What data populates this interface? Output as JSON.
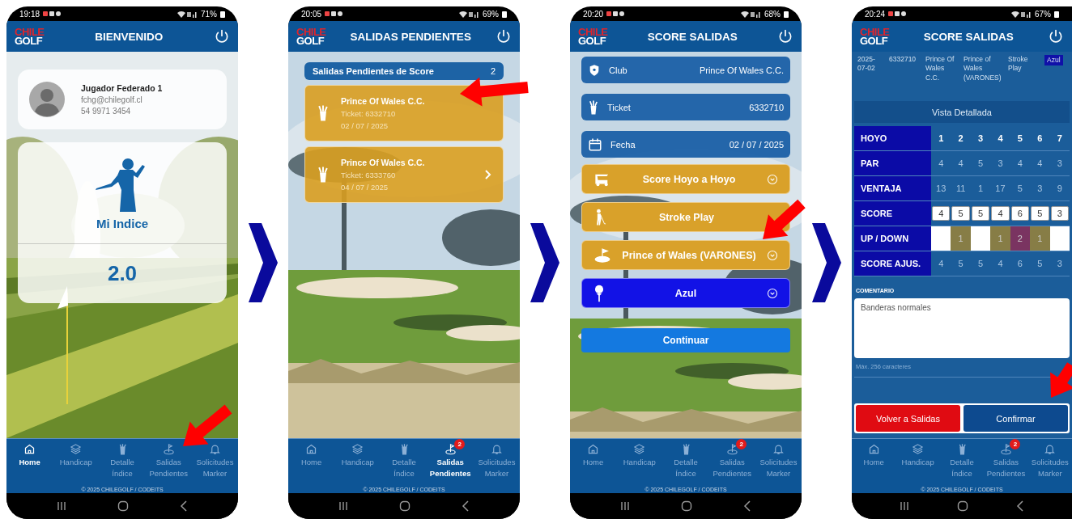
{
  "phones": [
    {
      "kind": "home",
      "status_bar": {
        "time": "19:18",
        "battery": "71%"
      },
      "header": {
        "logo_top": "CHILE",
        "logo_bottom": "GOLF",
        "title": "BIENVENIDO"
      },
      "profile": {
        "name": "Jugador Federado 1",
        "email": "fchg@chilegolf.cl",
        "phone": "54 9971 3454"
      },
      "index_card": {
        "label": "Mi Indice",
        "value": "2.0"
      },
      "nav": [
        {
          "label": "Home",
          "selected": true
        },
        {
          "label": "Handicap",
          "selected": false
        },
        {
          "label": "Detalle\nÍndice",
          "selected": false
        },
        {
          "label": "Salidas\nPendientes",
          "selected": false
        },
        {
          "label": "Solicitudes\nMarker",
          "selected": false
        }
      ],
      "copyright": "© 2025 CHILEGOLF / CODEITS"
    },
    {
      "kind": "pending",
      "status_bar": {
        "time": "20:05",
        "battery": "69%"
      },
      "header": {
        "logo_top": "CHILE",
        "logo_bottom": "GOLF",
        "title": "SALIDAS PENDIENTES"
      },
      "list_header": {
        "title": "Salidas Pendientes de Score",
        "count": "2"
      },
      "outings": [
        {
          "club": "Prince Of Wales C.C.",
          "ticket": "Ticket: 6332710",
          "date": "02 / 07 / 2025",
          "chevron": false
        },
        {
          "club": "Prince Of Wales C.C.",
          "ticket": "Ticket: 6333760",
          "date": "04 / 07 / 2025",
          "chevron": true
        }
      ],
      "nav": [
        {
          "label": "Home",
          "selected": false
        },
        {
          "label": "Handicap",
          "selected": false
        },
        {
          "label": "Detalle\nÍndice",
          "selected": false
        },
        {
          "label": "Salidas\nPendientes",
          "selected": true,
          "badge": "2"
        },
        {
          "label": "Solicitudes\nMarker",
          "selected": false
        }
      ],
      "copyright": "© 2025 CHILEGOLF / CODEITS"
    },
    {
      "kind": "score_form",
      "status_bar": {
        "time": "20:20",
        "battery": "68%"
      },
      "header": {
        "logo_top": "CHILE",
        "logo_bottom": "GOLF",
        "title": "SCORE SALIDAS"
      },
      "info_rows": [
        {
          "label": "Club",
          "value": "Prince Of Wales C.C."
        },
        {
          "label": "Ticket",
          "value": "6332710"
        },
        {
          "label": "Fecha",
          "value": "02 / 07 / 2025"
        }
      ],
      "selects": [
        {
          "label": "Score Hoyo a Hoyo",
          "color": "#d9a12a",
          "dropdown": true
        },
        {
          "label": "Stroke Play",
          "color": "#d9a12a",
          "dropdown": false
        },
        {
          "label": "Prince of Wales (VARONES)",
          "color": "#d9a12a",
          "dropdown": true
        },
        {
          "label": "Azul",
          "color": "#1212e6",
          "dropdown": true
        }
      ],
      "continue_button": "Continuar",
      "nav": [
        {
          "label": "Home",
          "selected": false
        },
        {
          "label": "Handicap",
          "selected": false
        },
        {
          "label": "Detalle\nÍndice",
          "selected": false
        },
        {
          "label": "Salidas\nPendientes",
          "selected": false,
          "badge": "2"
        },
        {
          "label": "Solicitudes\nMarker",
          "selected": false
        }
      ],
      "copyright": "© 2025 CHILEGOLF / CODEITS"
    },
    {
      "kind": "scorecard",
      "status_bar": {
        "time": "20:24",
        "battery": "67%"
      },
      "header": {
        "logo_top": "CHILE",
        "logo_bottom": "GOLF",
        "title": "SCORE SALIDAS"
      },
      "summary": [
        {
          "text": "2025-07-02",
          "highlighted": false
        },
        {
          "text": "6332710",
          "highlighted": false
        },
        {
          "text": "Prince Of Wales C.C.",
          "highlighted": false
        },
        {
          "text": "Prince of Wales (VARONES)",
          "highlighted": false
        },
        {
          "text": "Stroke Play",
          "highlighted": false
        },
        {
          "text": "Azul",
          "highlighted": true
        }
      ],
      "detail_bar": "Vista Detallada",
      "table": [
        {
          "label": "HOYO",
          "kind": "head",
          "cells": [
            "1",
            "2",
            "3",
            "4",
            "5",
            "6",
            "7"
          ]
        },
        {
          "label": "PAR",
          "kind": "plain",
          "cells": [
            "4",
            "4",
            "5",
            "3",
            "4",
            "4",
            "3"
          ]
        },
        {
          "label": "VENTAJA",
          "kind": "plain",
          "cells": [
            "13",
            "11",
            "1",
            "17",
            "5",
            "3",
            "9"
          ]
        },
        {
          "label": "SCORE",
          "kind": "input",
          "cells": [
            "4",
            "5",
            "5",
            "4",
            "6",
            "5",
            "3"
          ]
        },
        {
          "label": "UP / DOWN",
          "kind": "colored",
          "cells": [
            {
              "color": "#ffffff"
            },
            {
              "text": "1",
              "color": "#877d46"
            },
            {
              "color": "#ffffff"
            },
            {
              "text": "1",
              "color": "#877d46"
            },
            {
              "text": "2",
              "color": "#7a3461"
            },
            {
              "text": "1",
              "color": "#877d46"
            },
            {
              "color": "#ffffff"
            }
          ]
        },
        {
          "label": "SCORE AJUS.",
          "kind": "plain",
          "cells": [
            "4",
            "5",
            "5",
            "4",
            "6",
            "5",
            "3"
          ]
        }
      ],
      "comment": {
        "label": "COMENTARIO",
        "value": "Banderas normales",
        "hint": "Máx. 256 caracteres"
      },
      "buttons": [
        {
          "label": "Volver a Salidas",
          "kind": "danger"
        },
        {
          "label": "Confirmar",
          "kind": "primary"
        }
      ],
      "nav": [
        {
          "label": "Home",
          "selected": false
        },
        {
          "label": "Handicap",
          "selected": false
        },
        {
          "label": "Detalle\nÍndice",
          "selected": false
        },
        {
          "label": "Salidas\nPendientes",
          "selected": false,
          "badge": "2"
        },
        {
          "label": "Solicitudes\nMarker",
          "selected": false
        }
      ],
      "copyright": "© 2025 CHILEGOLF / CODEITS"
    }
  ]
}
